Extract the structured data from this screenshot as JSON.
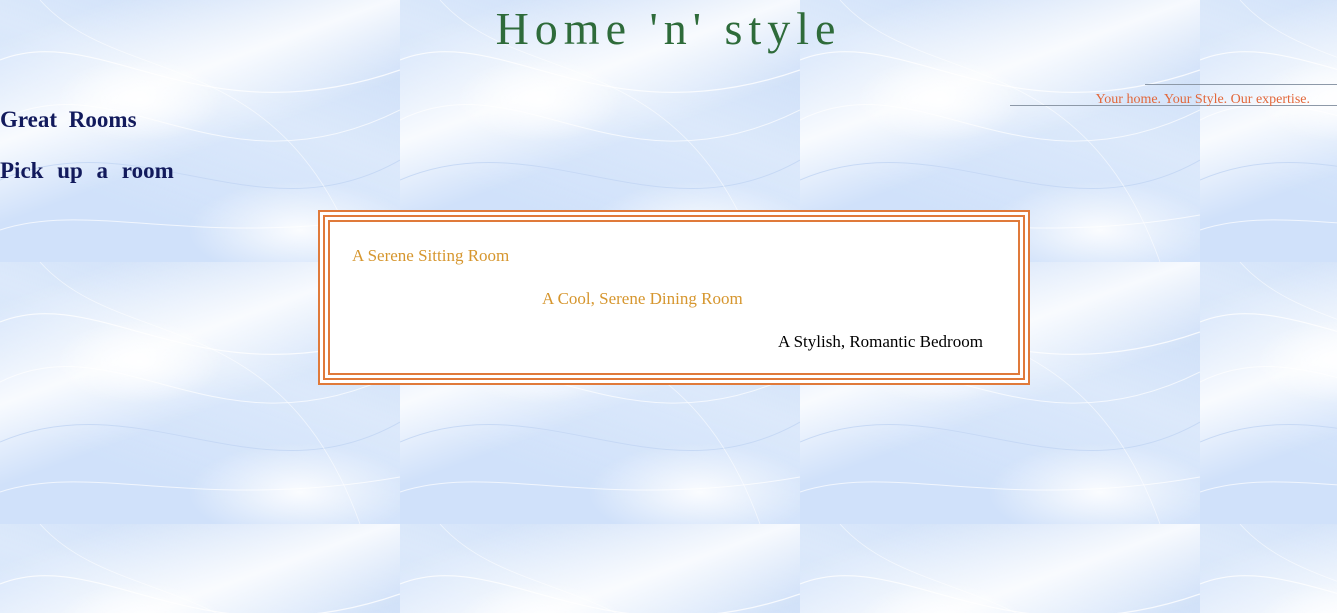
{
  "site": {
    "title": "Home 'n' style",
    "tagline": "Your home. Your Style. Our expertise."
  },
  "headings": {
    "great_rooms": "Great Rooms",
    "pick_room": "Pick up a room"
  },
  "rooms": [
    {
      "label": "A Serene Sitting Room"
    },
    {
      "label": "A Cool, Serene Dining Room"
    },
    {
      "label": "A Stylish, Romantic Bedroom"
    }
  ],
  "colors": {
    "title": "#2e6b3a",
    "tagline": "#e2673a",
    "headings": "#121a5c",
    "box_border": "#e07a3a",
    "room_link": "#d6962e",
    "room_link_active": "#000000"
  }
}
